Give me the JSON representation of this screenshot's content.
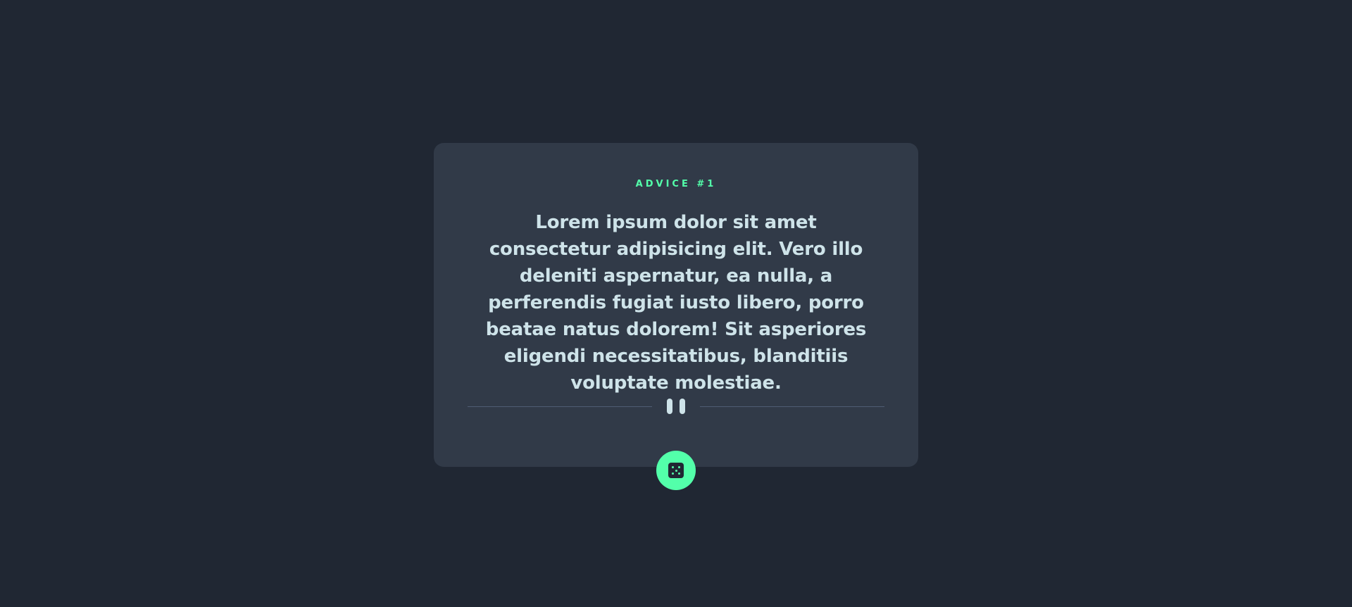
{
  "card": {
    "advice_label": "ADVICE #1",
    "advice_text": "Lorem ipsum dolor sit amet consectetur adipisicing elit. Vero illo deleniti aspernatur, ea nulla, a perferendis fugiat iusto libero, porro beatae natus dolorem! Sit asperiores eligendi necessitatibus, blanditiis voluptate molestiae."
  },
  "divider": {
    "icon": "pause-icon"
  },
  "dice_button": {
    "icon": "dice-icon"
  },
  "colors": {
    "background": "#202733",
    "card": "#313a48",
    "accent": "#53ffaa",
    "text": "#cee3e9",
    "divider": "#4f5d74"
  }
}
